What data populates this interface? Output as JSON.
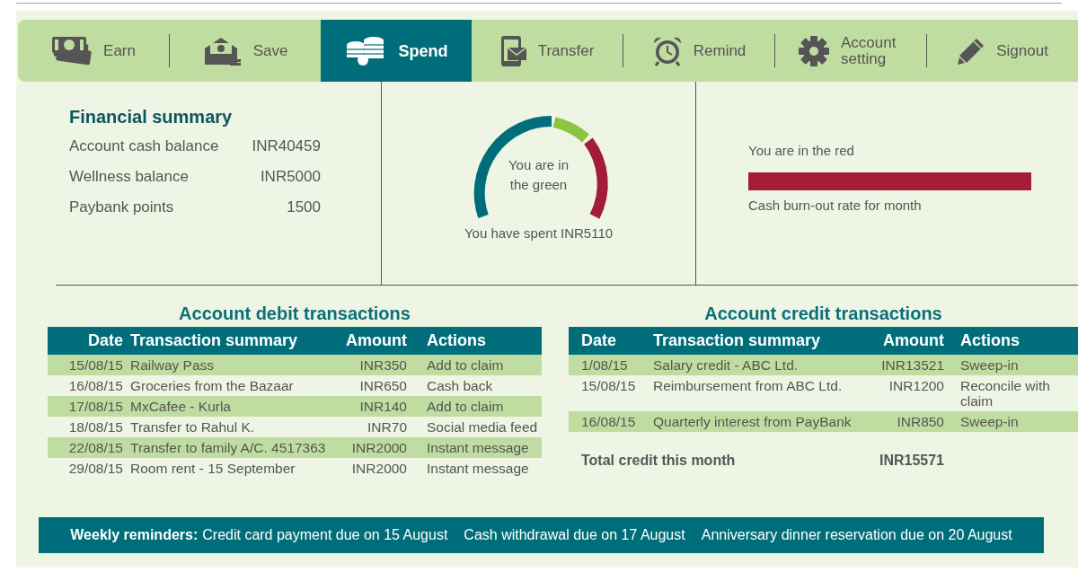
{
  "tabs": [
    {
      "label": "Earn",
      "kind": "cash",
      "selected": false
    },
    {
      "label": "Save",
      "kind": "envelope",
      "selected": false
    },
    {
      "label": "Spend",
      "kind": "coins",
      "selected": true
    },
    {
      "label": "Transfer",
      "kind": "tablet",
      "selected": false
    },
    {
      "label": "Remind",
      "kind": "alarm",
      "selected": false
    },
    {
      "label": "Account setting",
      "kind": "gear",
      "selected": false
    },
    {
      "label": "Signout",
      "kind": "pencil",
      "selected": false
    }
  ],
  "financial_summary": {
    "title": "Financial summary",
    "rows": [
      {
        "label": "Account cash balance",
        "value": "INR40459"
      },
      {
        "label": "Wellness balance",
        "value": "INR5000"
      },
      {
        "label": "Paybank points",
        "value": "1500"
      }
    ]
  },
  "gauge": {
    "caption": "You are in the green",
    "spent": "You have spent INR5110"
  },
  "burn_out": {
    "heading": "You are in the red",
    "caption": "Cash burn-out rate for month"
  },
  "debit": {
    "title": "Account debit transactions",
    "columns": [
      "Date",
      "Transaction summary",
      "Amount",
      "Actions"
    ],
    "rows": [
      [
        "15/08/15",
        "Railway Pass",
        "INR350",
        "Add to claim"
      ],
      [
        "16/08/15",
        "Groceries from the Bazaar",
        "INR650",
        "Cash back"
      ],
      [
        "17/08/15",
        "MxCafee - Kurla",
        "INR140",
        "Add to claim"
      ],
      [
        "18/08/15",
        "Transfer to Rahul K.",
        "INR70",
        "Social media feed"
      ],
      [
        "22/08/15",
        "Transfer to family A/C. 4517363",
        "INR2000",
        "Instant message"
      ],
      [
        "29/08/15",
        "Room rent - 15 September",
        "INR2000",
        "Instant message"
      ]
    ]
  },
  "credit": {
    "title": "Account credit transactions",
    "columns": [
      "Date",
      "Transaction summary",
      "Amount",
      "Actions"
    ],
    "rows": [
      [
        "1/08/15",
        "Salary credit - ABC Ltd.",
        "INR13521",
        "Sweep-in"
      ],
      [
        "15/08/15",
        "Reimbursement from ABC Ltd.",
        "INR1200",
        "Reconcile with claim"
      ],
      [
        "16/08/15",
        "Quarterly interest from PayBank",
        "INR850",
        "Sweep-in"
      ]
    ],
    "total_label": "Total credit this month",
    "total_value": "INR15571"
  },
  "reminders": {
    "label": "Weekly reminders:",
    "items": [
      "Credit card payment due on 15 August",
      "Cash withdrawal due on 17 August",
      "Anniversary dinner reservation due on 20 August"
    ]
  }
}
